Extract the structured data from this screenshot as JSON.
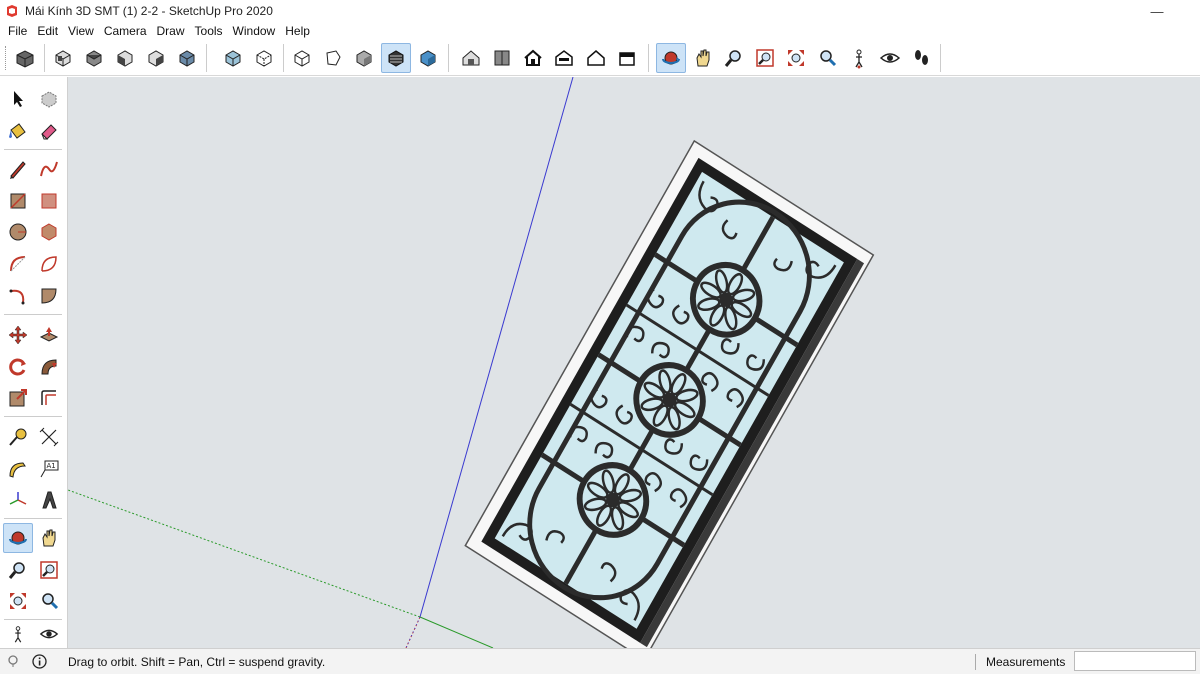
{
  "window": {
    "title": "Mái Kính 3D SMT (1) 2-2 - SketchUp Pro 2020",
    "minimize_glyph": "—"
  },
  "menu": {
    "items": [
      "File",
      "Edit",
      "View",
      "Camera",
      "Draw",
      "Tools",
      "Window",
      "Help"
    ]
  },
  "toolbar": {
    "buttons": [
      {
        "name": "component-icon"
      },
      {
        "name": "iso-view-icon"
      },
      {
        "name": "top-view-icon"
      },
      {
        "name": "front-view-icon"
      },
      {
        "name": "right-view-icon"
      },
      {
        "name": "back-view-icon"
      },
      {
        "name": "left-view-icon"
      },
      {
        "name": "xray-icon"
      },
      {
        "name": "back-edges-icon"
      },
      {
        "name": "wireframe-icon"
      },
      {
        "name": "hidden-line-icon"
      },
      {
        "name": "shaded-icon"
      },
      {
        "name": "shaded-textures-icon"
      },
      {
        "name": "monochrome-icon"
      },
      {
        "name": "warehouse-icon"
      },
      {
        "name": "extension-warehouse-icon"
      },
      {
        "name": "house-icon"
      },
      {
        "name": "share-model-icon"
      },
      {
        "name": "house-outline-icon"
      },
      {
        "name": "upload-icon"
      },
      {
        "name": "orbit-icon"
      },
      {
        "name": "pan-icon"
      },
      {
        "name": "zoom-icon"
      },
      {
        "name": "zoom-window-icon"
      },
      {
        "name": "zoom-extents-icon"
      },
      {
        "name": "previous-view-icon"
      },
      {
        "name": "position-camera-icon"
      },
      {
        "name": "look-around-icon"
      },
      {
        "name": "walk-icon"
      }
    ]
  },
  "palette": {
    "buttons": [
      "select-icon",
      "make-component-icon",
      "paint-bucket-icon",
      "eraser-icon",
      "line-icon",
      "freehand-icon",
      "rectangle-icon",
      "rotated-rectangle-icon",
      "circle-icon",
      "polygon-icon",
      "arc-icon",
      "two-point-arc-icon",
      "three-point-arc-icon",
      "pie-icon",
      "move-icon",
      "push-pull-icon",
      "rotate-icon",
      "follow-me-icon",
      "scale-icon",
      "offset-icon",
      "tape-measure-icon",
      "dimension-icon",
      "protractor-icon",
      "text-icon",
      "axes-icon",
      "3d-text-icon",
      "orbit-icon",
      "pan-icon",
      "zoom-icon",
      "zoom-window-icon",
      "zoom-extents-icon",
      "previous-icon",
      "position-camera-icon",
      "look-around-icon"
    ]
  },
  "status": {
    "message": "Drag to orbit. Shift = Pan, Ctrl = suspend gravity.",
    "measurements_label": "Measurements",
    "measurements_value": ""
  },
  "colors": {
    "viewport_bg": "#dfe3e6",
    "glass": "#cfe9ef",
    "iron": "#2b2b2b",
    "active_tool": "#cde3f7",
    "axis_blue": "#3a3ad0",
    "axis_green": "#2a9a2a",
    "axis_red": "#c03030"
  }
}
